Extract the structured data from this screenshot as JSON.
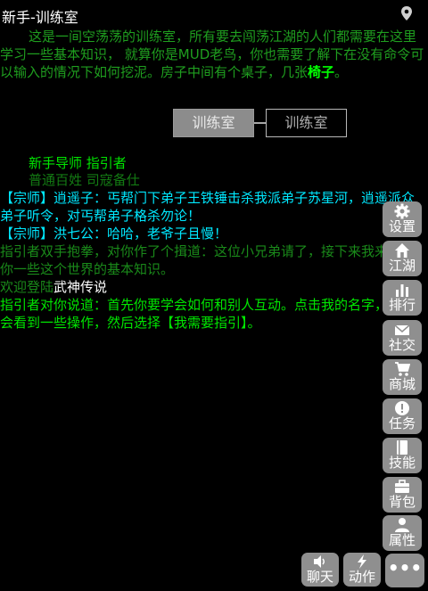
{
  "room": {
    "title": "新手-训练室",
    "description_parts": [
      "这是一间空荡荡的训练室，所有要去闯荡江湖的人们都需要在这里学习一些基本知识， 就算你是MUD老鸟，你也需要了解下在没有命令可以输入的情况下如何挖泥。房子中间有个桌子，几张",
      "椅子",
      "。"
    ]
  },
  "map": {
    "current": "训练室",
    "exit": "训练室"
  },
  "npc": {
    "name": "新手导师 指引者",
    "title": "普通百姓 司寇备仕"
  },
  "log": [
    {
      "color": "cyan",
      "text": "【宗师】逍遥子：丐帮门下弟子王铁锤击杀我派弟子苏星河，逍遥派众弟子听令，对丐帮弟子格杀勿论！"
    },
    {
      "color": "cyan",
      "text": "【宗师】洪七公：哈哈，老爷子且慢！"
    },
    {
      "color": "dgreen",
      "text": "指引者双手抱拳，对你作了个揖道：这位小兄弟请了，接下来我来告诉你一些这个世界的基本知识。"
    },
    {
      "color": "mixed",
      "prefix": "欢迎登陆",
      "highlight": "武神传说"
    },
    {
      "color": "green",
      "text": "指引者对你说道：首先你要学会如何和别人互动。点击我的名字，你将会看到一些操作，然后选择【我需要指引】。"
    }
  ],
  "side_buttons": [
    {
      "label": "设置",
      "icon": "gear-icon"
    },
    {
      "label": "江湖",
      "icon": "home-icon"
    },
    {
      "label": "排行",
      "icon": "bar-chart-icon"
    },
    {
      "label": "社交",
      "icon": "envelope-icon"
    },
    {
      "label": "商城",
      "icon": "cart-icon"
    },
    {
      "label": "任务",
      "icon": "alert-icon"
    },
    {
      "label": "技能",
      "icon": "book-icon"
    },
    {
      "label": "背包",
      "icon": "briefcase-icon"
    },
    {
      "label": "属性",
      "icon": "user-icon"
    }
  ],
  "bottom_buttons": [
    {
      "label": "聊天",
      "icon": "speaker-icon"
    },
    {
      "label": "动作",
      "icon": "bolt-icon"
    }
  ],
  "more_label": "•••"
}
